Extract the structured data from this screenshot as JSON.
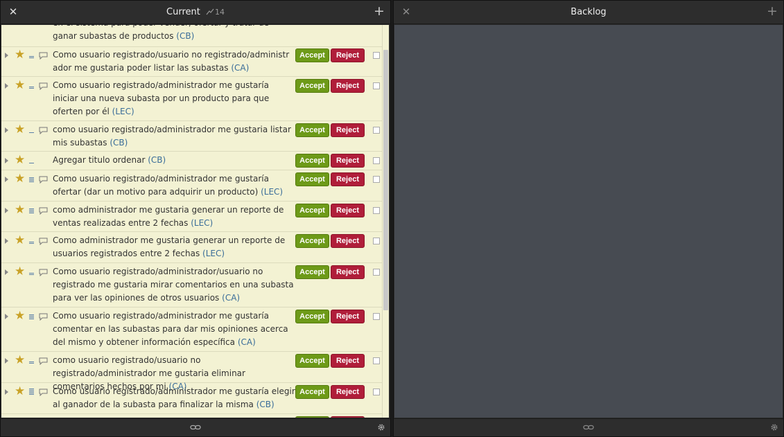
{
  "current": {
    "title": "Current",
    "points": "14",
    "close_icon": "close-icon",
    "add_icon": "plus-icon",
    "partial_story_title": "en el sistema para poder vender, ofertar y tratar de ganar subastas de productos",
    "partial_story_epic": "(CB)",
    "stories": [
      {
        "title": "Como usuario registrado/usuario no registrado/administr ador me gustaria poder listar las subastas",
        "epic": "(CA)",
        "accept": "Accept",
        "reject": "Reject",
        "estimate": 1,
        "comment": true
      },
      {
        "title": "Como usuario registrado/administrador me gustaría iniciar una nueva subasta por un producto para que oferten por él",
        "epic": "(LEC)",
        "accept": "Accept",
        "reject": "Reject",
        "estimate": 1,
        "comment": true
      },
      {
        "title": "como usuario registrado/administrador me gustaria listar mis subastas",
        "epic": "(CB)",
        "accept": "Accept",
        "reject": "Reject",
        "estimate": 0,
        "comment": true
      },
      {
        "title": "Agregar titulo ordenar",
        "epic": "(CB)",
        "accept": "Accept",
        "reject": "Reject",
        "estimate": 0,
        "comment": false
      },
      {
        "title": "Como usuario registrado/administrador me gustaría ofertar (dar un motivo para adquirir un producto)",
        "epic": "(LEC)",
        "accept": "Accept",
        "reject": "Reject",
        "estimate": 5,
        "comment": true
      },
      {
        "title": "como administrador me gustaria generar un reporte de ventas realizadas entre 2 fechas ",
        "epic": "(LEC)",
        "accept": "Accept",
        "reject": "Reject",
        "estimate": 5,
        "comment": true
      },
      {
        "title": "Como administrador me gustaria generar un reporte de usuarios registrados entre 2 fechas",
        "epic": "(LEC)",
        "accept": "Accept",
        "reject": "Reject",
        "estimate": 1,
        "comment": true
      },
      {
        "title": "Como usuario registrado/administrador/usuario no registrado me gustaria mirar comentarios en una subasta para ver las opiniones de otros usuarios",
        "epic": "(CA)",
        "accept": "Accept",
        "reject": "Reject",
        "estimate": 1,
        "comment": true
      },
      {
        "title": "Como usuario registrado/administrador me gustaría comentar en las subastas para dar mis opiniones acerca del mismo y obtener información específica",
        "epic": "(CA)",
        "accept": "Accept",
        "reject": "Reject",
        "estimate": 5,
        "comment": true
      },
      {
        "title": "como usuario registrado/usuario no registrado/administrador me gustaria eliminar comentarios hechos por mi",
        "epic": "(CA)",
        "accept": "Accept",
        "reject": "Reject",
        "estimate": 1,
        "comment": true
      },
      {
        "title": "Como usuario registrado/administrador me gustaría elegir al ganador de la subasta para finalizar la misma ",
        "epic": "(CB)",
        "accept": "Accept",
        "reject": "Reject",
        "estimate": 8,
        "comment": true
      }
    ]
  },
  "backlog": {
    "title": "Backlog",
    "close_icon": "close-icon",
    "add_icon": "plus-icon"
  },
  "footer": {
    "link_icon": "link-icon",
    "gear_icon": "gear-icon"
  },
  "colors": {
    "story_bg": "#f3f2d3",
    "accept": "#6d9a18",
    "reject": "#b01e3a",
    "epic_label": "#3a6d99",
    "backlog_bg": "#474b52"
  }
}
